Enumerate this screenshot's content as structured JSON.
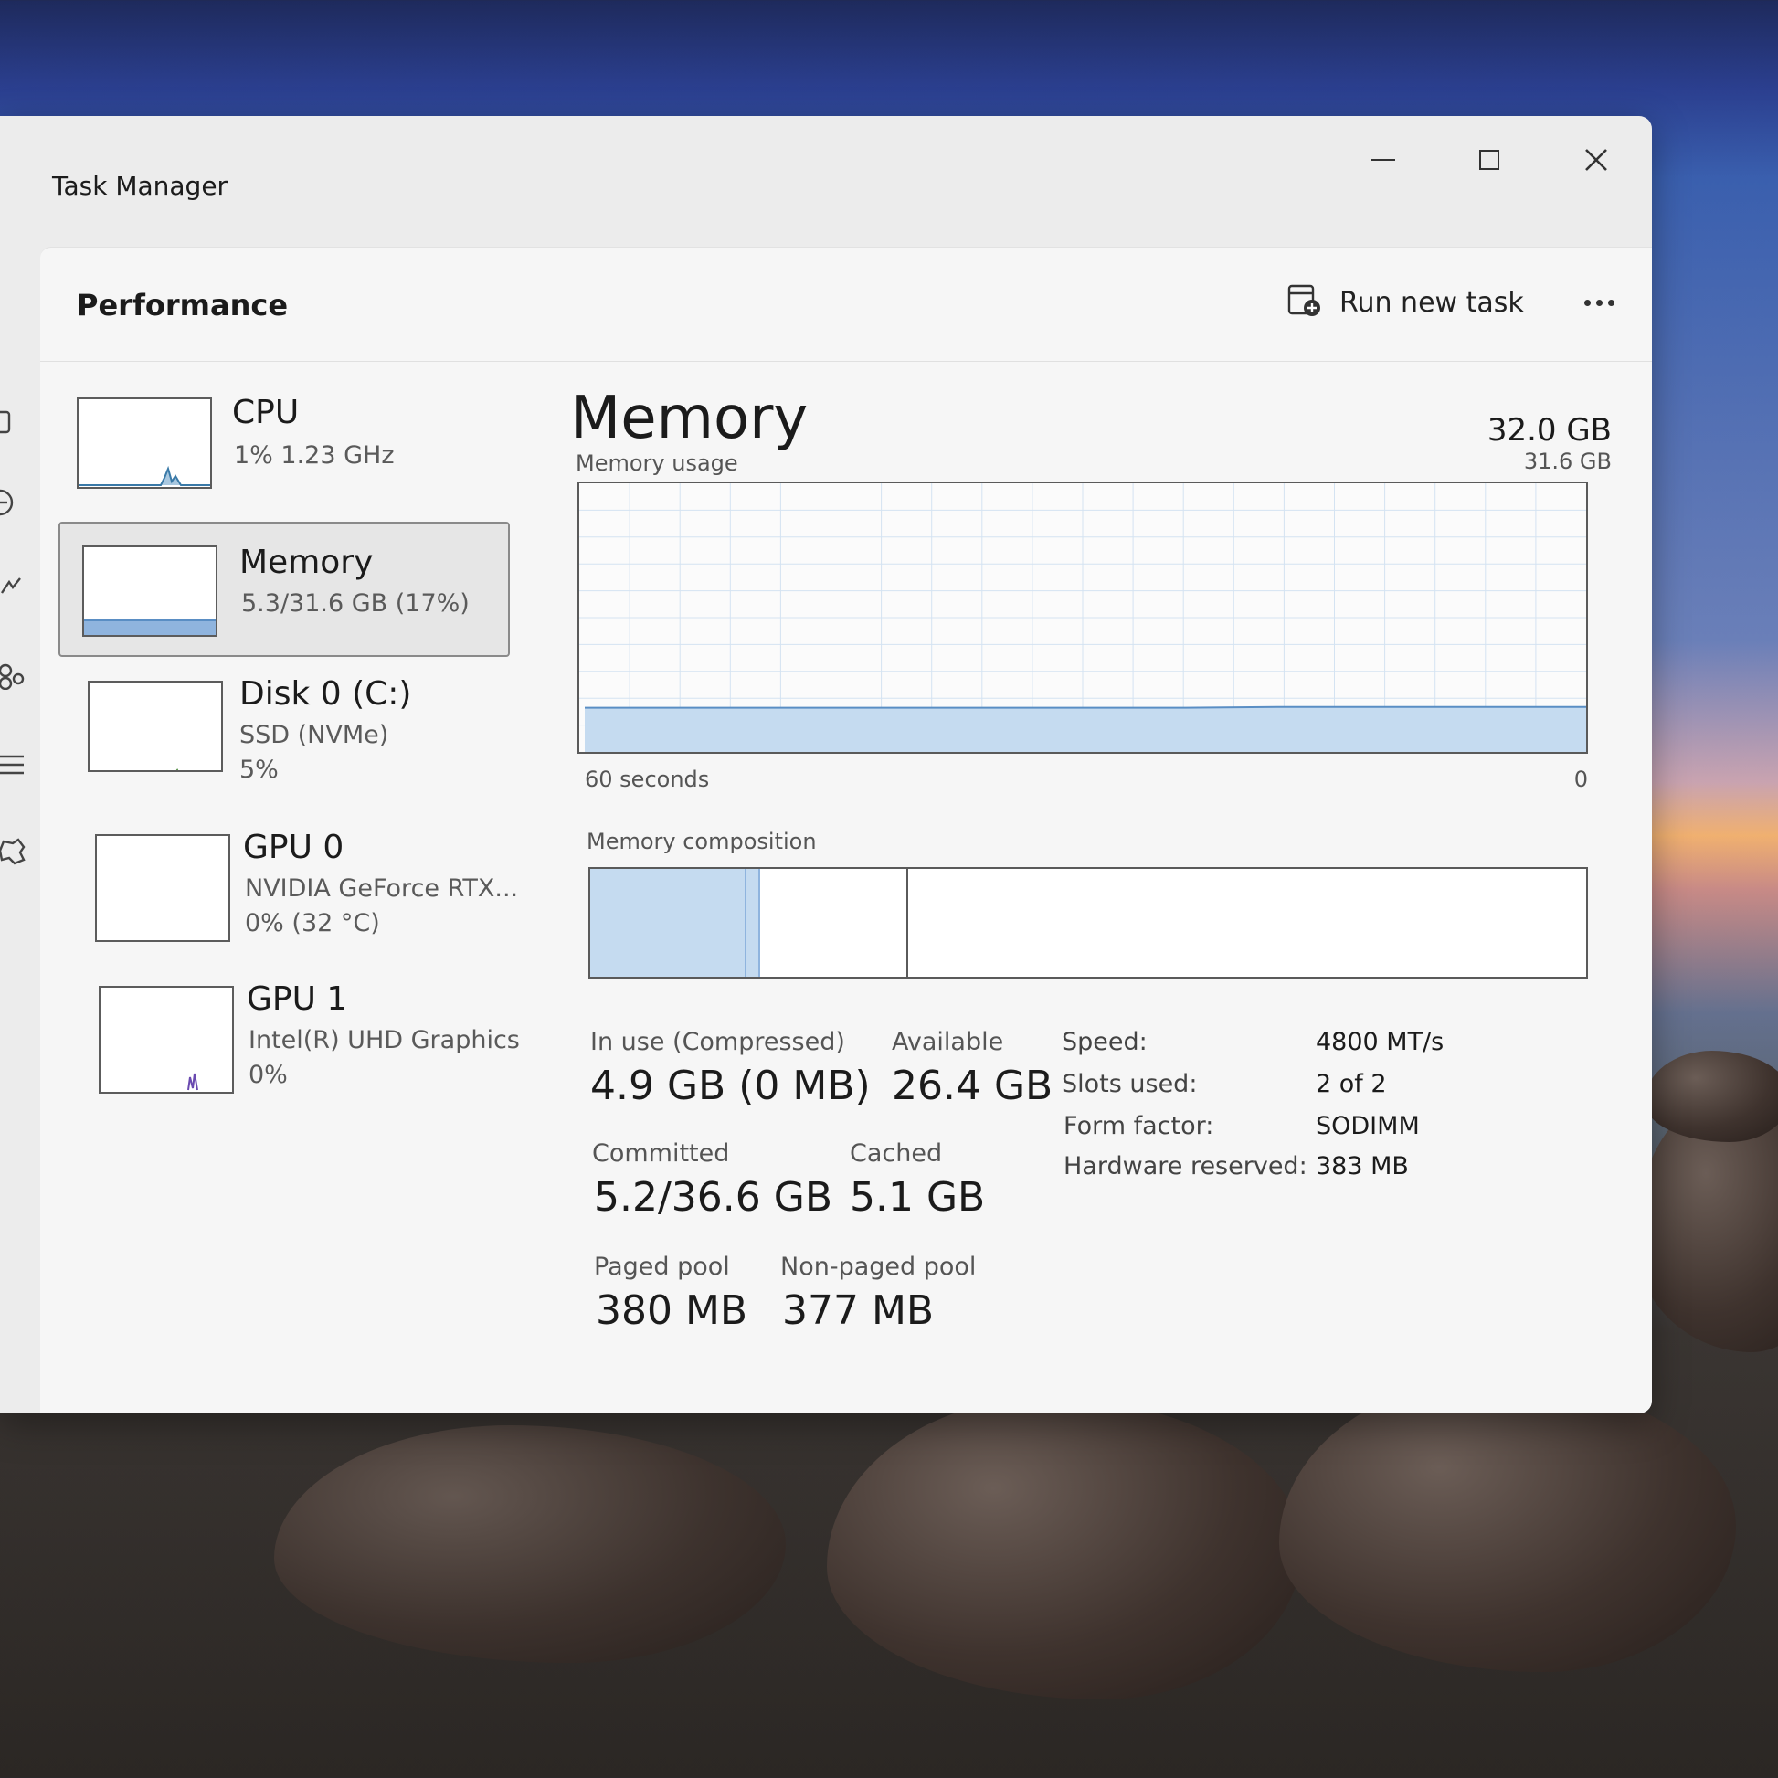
{
  "window": {
    "title": "Task Manager"
  },
  "header": {
    "title": "Performance",
    "run_task_label": "Run new task"
  },
  "sidebar": {
    "items": [
      {
        "name": "CPU",
        "line1": "1%  1.23 GHz",
        "line2": ""
      },
      {
        "name": "Memory",
        "line1": "5.3/31.6 GB (17%)",
        "line2": ""
      },
      {
        "name": "Disk 0 (C:)",
        "line1": "SSD (NVMe)",
        "line2": "5%"
      },
      {
        "name": "GPU 0",
        "line1": "NVIDIA GeForce RTX...",
        "line2": "0%  (32 °C)"
      },
      {
        "name": "GPU 1",
        "line1": "Intel(R) UHD Graphics",
        "line2": "0%"
      }
    ]
  },
  "main": {
    "title": "Memory",
    "total": "32.0 GB",
    "usage_label": "Memory usage",
    "usage_max": "31.6 GB",
    "time_left": "60 seconds",
    "time_right": "0",
    "composition_label": "Memory composition",
    "stats": {
      "in_use_label": "In use (Compressed)",
      "in_use_value": "4.9 GB (0 MB)",
      "available_label": "Available",
      "available_value": "26.4 GB",
      "committed_label": "Committed",
      "committed_value": "5.2/36.6 GB",
      "cached_label": "Cached",
      "cached_value": "5.1 GB",
      "paged_label": "Paged pool",
      "paged_value": "380 MB",
      "nonpaged_label": "Non-paged pool",
      "nonpaged_value": "377 MB"
    },
    "details": {
      "speed_label": "Speed:",
      "speed_value": "4800 MT/s",
      "slots_label": "Slots used:",
      "slots_value": "2 of 2",
      "form_label": "Form factor:",
      "form_value": "SODIMM",
      "hw_label": "Hardware reserved:",
      "hw_value": "383 MB"
    }
  },
  "chart_data": {
    "type": "area",
    "title": "Memory usage",
    "xlabel": "",
    "ylabel": "",
    "xlim": [
      60,
      0
    ],
    "ylim": [
      0,
      31.6
    ],
    "grid": true,
    "series": [
      {
        "x": [
          60,
          51,
          42,
          33,
          24,
          18,
          12,
          6,
          0
        ],
        "values": [
          5.2,
          5.2,
          5.2,
          5.2,
          5.2,
          5.3,
          5.3,
          5.3,
          5.3
        ]
      }
    ]
  },
  "composition": {
    "in_use_fraction": 0.155,
    "modified_fraction": 0.012,
    "standby_fraction": 0.15
  },
  "colors": {
    "memory_accent": "#8fb4de",
    "memory_fill": "#c5dbf0",
    "grid": "#d4e3f2"
  },
  "icons": {
    "close": "close-icon",
    "minimize": "minimize-icon",
    "maximize": "maximize-icon",
    "run_task": "run-task-icon",
    "more": "more-icon",
    "settings": "gear-icon"
  }
}
